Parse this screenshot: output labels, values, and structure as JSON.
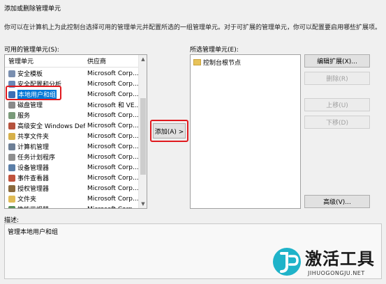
{
  "dialog": {
    "title": "添加或删除管理单元",
    "intro": "你可以在计算机上为此控制台选择可用的管理单元并配置所选的一组管理单元。对于可扩展的管理单元，你可以配置要启用哪些扩展项。"
  },
  "available": {
    "label": "可用的管理单元(S):",
    "columns": {
      "name": "管理单元",
      "vendor": "供应商"
    },
    "rows": [
      {
        "name": "安全模板",
        "vendor": "Microsoft Corp...",
        "icon": "security-template-icon",
        "color": "#7a8fb0"
      },
      {
        "name": "安全配置和分析",
        "vendor": "Microsoft Corp...",
        "icon": "security-config-icon",
        "color": "#6a88b8"
      },
      {
        "name": "本地用户和组",
        "vendor": "Microsoft Corp...",
        "icon": "users-icon",
        "color": "#3d6fb5"
      },
      {
        "name": "磁盘管理",
        "vendor": "Microsoft 和 VE...",
        "icon": "disk-icon",
        "color": "#8a8a8a"
      },
      {
        "name": "服务",
        "vendor": "Microsoft Corp...",
        "icon": "services-icon",
        "color": "#7a9a7a"
      },
      {
        "name": "高级安全 Windows Def...",
        "vendor": "Microsoft Corp...",
        "icon": "firewall-icon",
        "color": "#b5523d"
      },
      {
        "name": "共享文件夹",
        "vendor": "Microsoft Corp...",
        "icon": "shared-folder-icon",
        "color": "#d6b04a"
      },
      {
        "name": "计算机管理",
        "vendor": "Microsoft Corp...",
        "icon": "computer-management-icon",
        "color": "#6d7f96"
      },
      {
        "name": "任务计划程序",
        "vendor": "Microsoft Corp...",
        "icon": "task-scheduler-icon",
        "color": "#8f8f8f"
      },
      {
        "name": "设备管理器",
        "vendor": "Microsoft Corp...",
        "icon": "device-manager-icon",
        "color": "#5b7fa8"
      },
      {
        "name": "事件查看器",
        "vendor": "Microsoft Corp...",
        "icon": "event-viewer-icon",
        "color": "#c0533d"
      },
      {
        "name": "授权管理器",
        "vendor": "Microsoft Corp...",
        "icon": "authorization-manager-icon",
        "color": "#8a6a3d"
      },
      {
        "name": "文件夹",
        "vendor": "Microsoft Corp...",
        "icon": "folder-icon",
        "color": "#e0bb55"
      },
      {
        "name": "性能监视器",
        "vendor": "Microsoft Corp...",
        "icon": "performance-monitor-icon",
        "color": "#5a8f5a"
      }
    ],
    "selected_index": 2
  },
  "add_button": {
    "label": "添加(A) >"
  },
  "selected": {
    "label": "所选管理单元(E):",
    "items": [
      {
        "name": "控制台根节点",
        "icon": "folder-icon"
      }
    ]
  },
  "buttons": {
    "edit_extensions": "编辑扩展(X)...",
    "remove": "删除(R)",
    "move_up": "上移(U)",
    "move_down": "下移(D)",
    "advanced": "高级(V)..."
  },
  "description": {
    "label": "描述:",
    "text": "管理本地用户和组"
  },
  "watermark": {
    "brand": "激活工具",
    "url": "JIHUOGONGJU.NET"
  },
  "colors": {
    "selection": "#0078d7",
    "highlight_box": "#e0191e"
  }
}
